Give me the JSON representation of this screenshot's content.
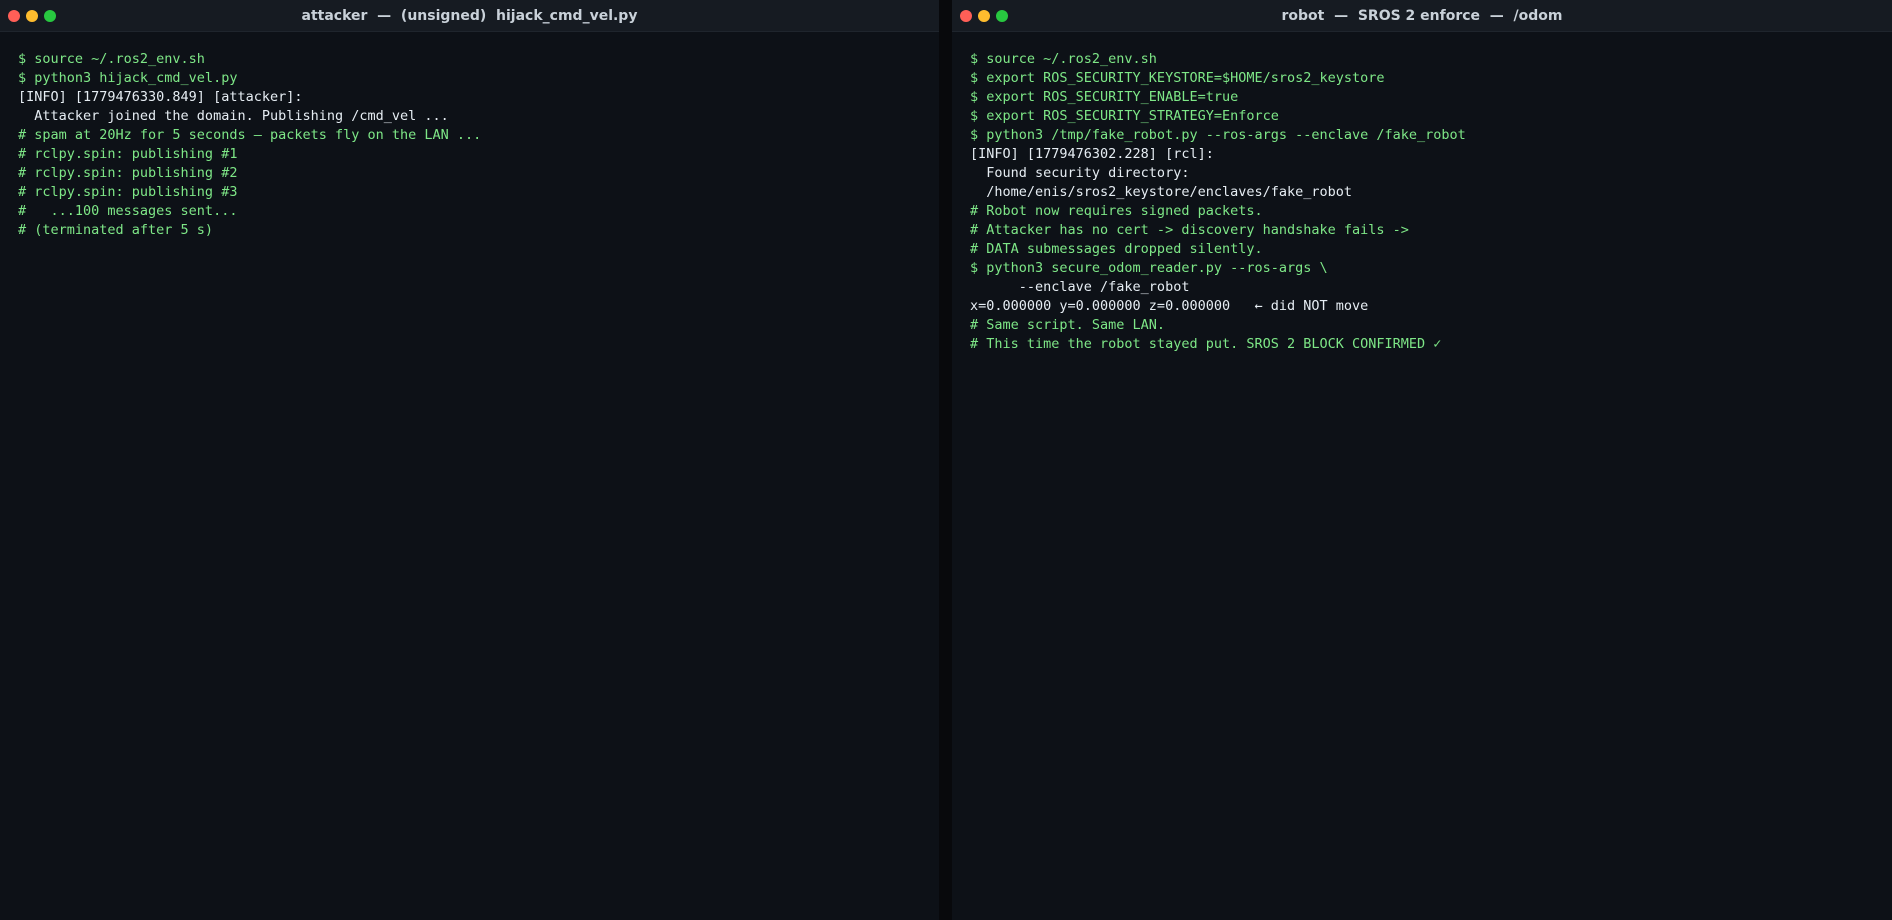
{
  "left_terminal": {
    "title": "attacker  —  (unsigned)  hijack_cmd_vel.py",
    "lines": [
      {
        "text": "$ source ~/.ros2_env.sh",
        "style": "green"
      },
      {
        "text": "$ python3 hijack_cmd_vel.py",
        "style": "green"
      },
      {
        "text": "[INFO] [1779476330.849] [attacker]:",
        "style": "white"
      },
      {
        "text": "  Attacker joined the domain. Publishing /cmd_vel ...",
        "style": "white"
      },
      {
        "text": "# spam at 20Hz for 5 seconds — packets fly on the LAN ...",
        "style": "green"
      },
      {
        "text": "# rclpy.spin: publishing #1",
        "style": "green"
      },
      {
        "text": "# rclpy.spin: publishing #2",
        "style": "green"
      },
      {
        "text": "# rclpy.spin: publishing #3",
        "style": "green"
      },
      {
        "text": "#   ...100 messages sent...",
        "style": "green"
      },
      {
        "text": "# (terminated after 5 s)",
        "style": "green"
      }
    ]
  },
  "right_terminal": {
    "title": "robot  —  SROS 2 enforce  —  /odom",
    "lines": [
      {
        "text": "$ source ~/.ros2_env.sh",
        "style": "green"
      },
      {
        "text": "$ export ROS_SECURITY_KEYSTORE=$HOME/sros2_keystore",
        "style": "green"
      },
      {
        "text": "$ export ROS_SECURITY_ENABLE=true",
        "style": "green"
      },
      {
        "text": "$ export ROS_SECURITY_STRATEGY=Enforce",
        "style": "green"
      },
      {
        "text": "$ python3 /tmp/fake_robot.py --ros-args --enclave /fake_robot",
        "style": "green"
      },
      {
        "text": "[INFO] [1779476302.228] [rcl]:",
        "style": "white"
      },
      {
        "text": "  Found security directory:",
        "style": "white"
      },
      {
        "text": "  /home/enis/sros2_keystore/enclaves/fake_robot",
        "style": "white"
      },
      {
        "text": "# Robot now requires signed packets.",
        "style": "green"
      },
      {
        "text": "# Attacker has no cert -> discovery handshake fails ->",
        "style": "green"
      },
      {
        "text": "# DATA submessages dropped silently.",
        "style": "green"
      },
      {
        "text": "$ python3 secure_odom_reader.py --ros-args \\",
        "style": "green"
      },
      {
        "text": "      --enclave /fake_robot",
        "style": "white"
      },
      {
        "text": "x=0.000000 y=0.000000 z=0.000000   ← did NOT move",
        "style": "white"
      },
      {
        "text": "# Same script. Same LAN.",
        "style": "green"
      },
      {
        "text": "# This time the robot stayed put. SROS 2 BLOCK CONFIRMED ✓",
        "style": "green"
      }
    ]
  },
  "colors": {
    "background": "#0d1117",
    "titlebar": "#161b22",
    "comment_green": "#7ee787",
    "output_white": "#e6edf3",
    "close_red": "#ff5f57",
    "minimize_yellow": "#febc2e",
    "maximize_green": "#28c840"
  }
}
